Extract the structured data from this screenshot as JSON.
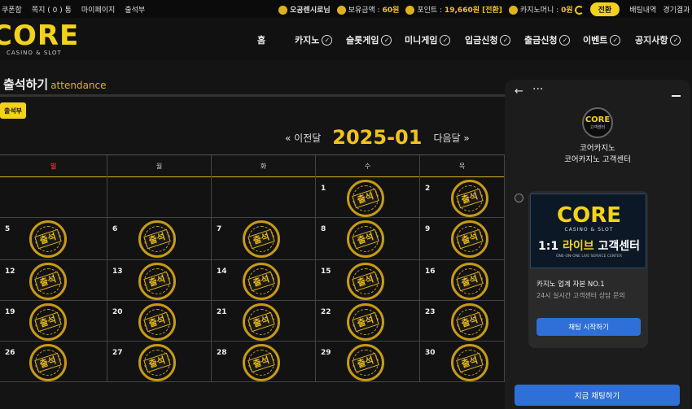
{
  "topbar": {
    "links": [
      "쿠폰함",
      "쪽지 ( 0 ) 통",
      "마이페이지",
      "출석부"
    ],
    "user": "오공렌시로님",
    "balance_label": "보유금액 : ",
    "balance_value": "60원",
    "points_label": "포인트 : ",
    "points_value": "19,660원 [전환]",
    "casino_money_label": "카지노머니 : ",
    "casino_money_value": "0원",
    "swap_label": "전환",
    "bet_history": "배팅내역",
    "game_results": "경기결과"
  },
  "header": {
    "logo_main": "CORE",
    "logo_sub": "CASINO & SLOT",
    "nav": [
      "홈",
      "카지노",
      "슬롯게임",
      "미니게임",
      "입금신청",
      "출금신청",
      "이벤트",
      "공지사항"
    ]
  },
  "page": {
    "title": "출석하기",
    "title_sub": "attendance",
    "attendance_button": "출석부",
    "prev_label": "« 이전달",
    "month": "2025-01",
    "next_label": "다음달 »"
  },
  "calendar": {
    "daynames": [
      "일",
      "월",
      "화",
      "수",
      "목"
    ],
    "weeks": [
      [
        null,
        null,
        null,
        "1",
        "2"
      ],
      [
        "5",
        "6",
        "7",
        "8",
        "9"
      ],
      [
        "12",
        "13",
        "14",
        "15",
        "16"
      ],
      [
        "19",
        "20",
        "21",
        "22",
        "23"
      ],
      [
        "26",
        "27",
        "28",
        "29",
        "30"
      ]
    ],
    "stamp_text": "출석"
  },
  "chat": {
    "avatar_main": "CORE",
    "avatar_sub": "고객센터",
    "name_line1": "코어카지노",
    "name_line2": "코어카지노 고객센터",
    "banner_logo": "CORE",
    "banner_sub": "CASINO & SLOT",
    "banner_title_a": "1:1 ",
    "banner_title_b": "라이브 ",
    "banner_title_c": "고객센터",
    "banner_foot": "ONE-ON-ONE LIVE SERVICE CENTER",
    "headline": "카지노 업계 자본 NO.1",
    "desc": "24시 실시간 고객센터 상담 문의",
    "start_button": "채팅 시작하기",
    "cta_button": "지금 채팅하기"
  },
  "colors": {
    "accent": "#f2d31a",
    "button_blue": "#2e6fd8",
    "sunday": "#e03030"
  }
}
